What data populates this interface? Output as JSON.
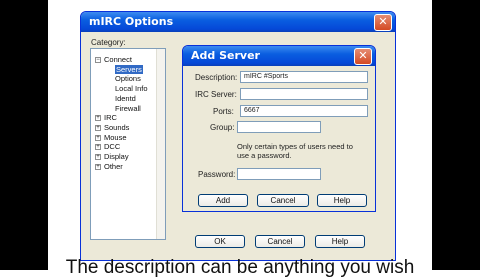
{
  "options_window": {
    "title": "mIRC Options",
    "close_glyph": "✕",
    "category_label": "Category:",
    "tree": [
      {
        "label": "Connect",
        "expander": "−"
      },
      {
        "label": "Servers",
        "selected": true
      },
      {
        "label": "Options"
      },
      {
        "label": "Local Info"
      },
      {
        "label": "Identd"
      },
      {
        "label": "Firewall"
      },
      {
        "label": "IRC",
        "expander": "+"
      },
      {
        "label": "Sounds",
        "expander": "+"
      },
      {
        "label": "Mouse",
        "expander": "+"
      },
      {
        "label": "DCC",
        "expander": "+"
      },
      {
        "label": "Display",
        "expander": "+"
      },
      {
        "label": "Other",
        "expander": "+"
      }
    ],
    "buttons": {
      "ok": "OK",
      "cancel": "Cancel",
      "help": "Help"
    }
  },
  "add_server": {
    "title": "Add Server",
    "close_glyph": "✕",
    "description_label": "Description:",
    "description_value": "mIRC #Sports",
    "irc_server_label": "IRC Server:",
    "irc_server_value": "",
    "ports_label": "Ports:",
    "ports_value": "6667",
    "group_label": "Group:",
    "group_value": "",
    "hint": "Only certain types of users need to use a password.",
    "password_label": "Password:",
    "password_value": "",
    "buttons": {
      "add": "Add",
      "cancel": "Cancel",
      "help": "Help"
    }
  },
  "caption": "The description can be anything you wish"
}
